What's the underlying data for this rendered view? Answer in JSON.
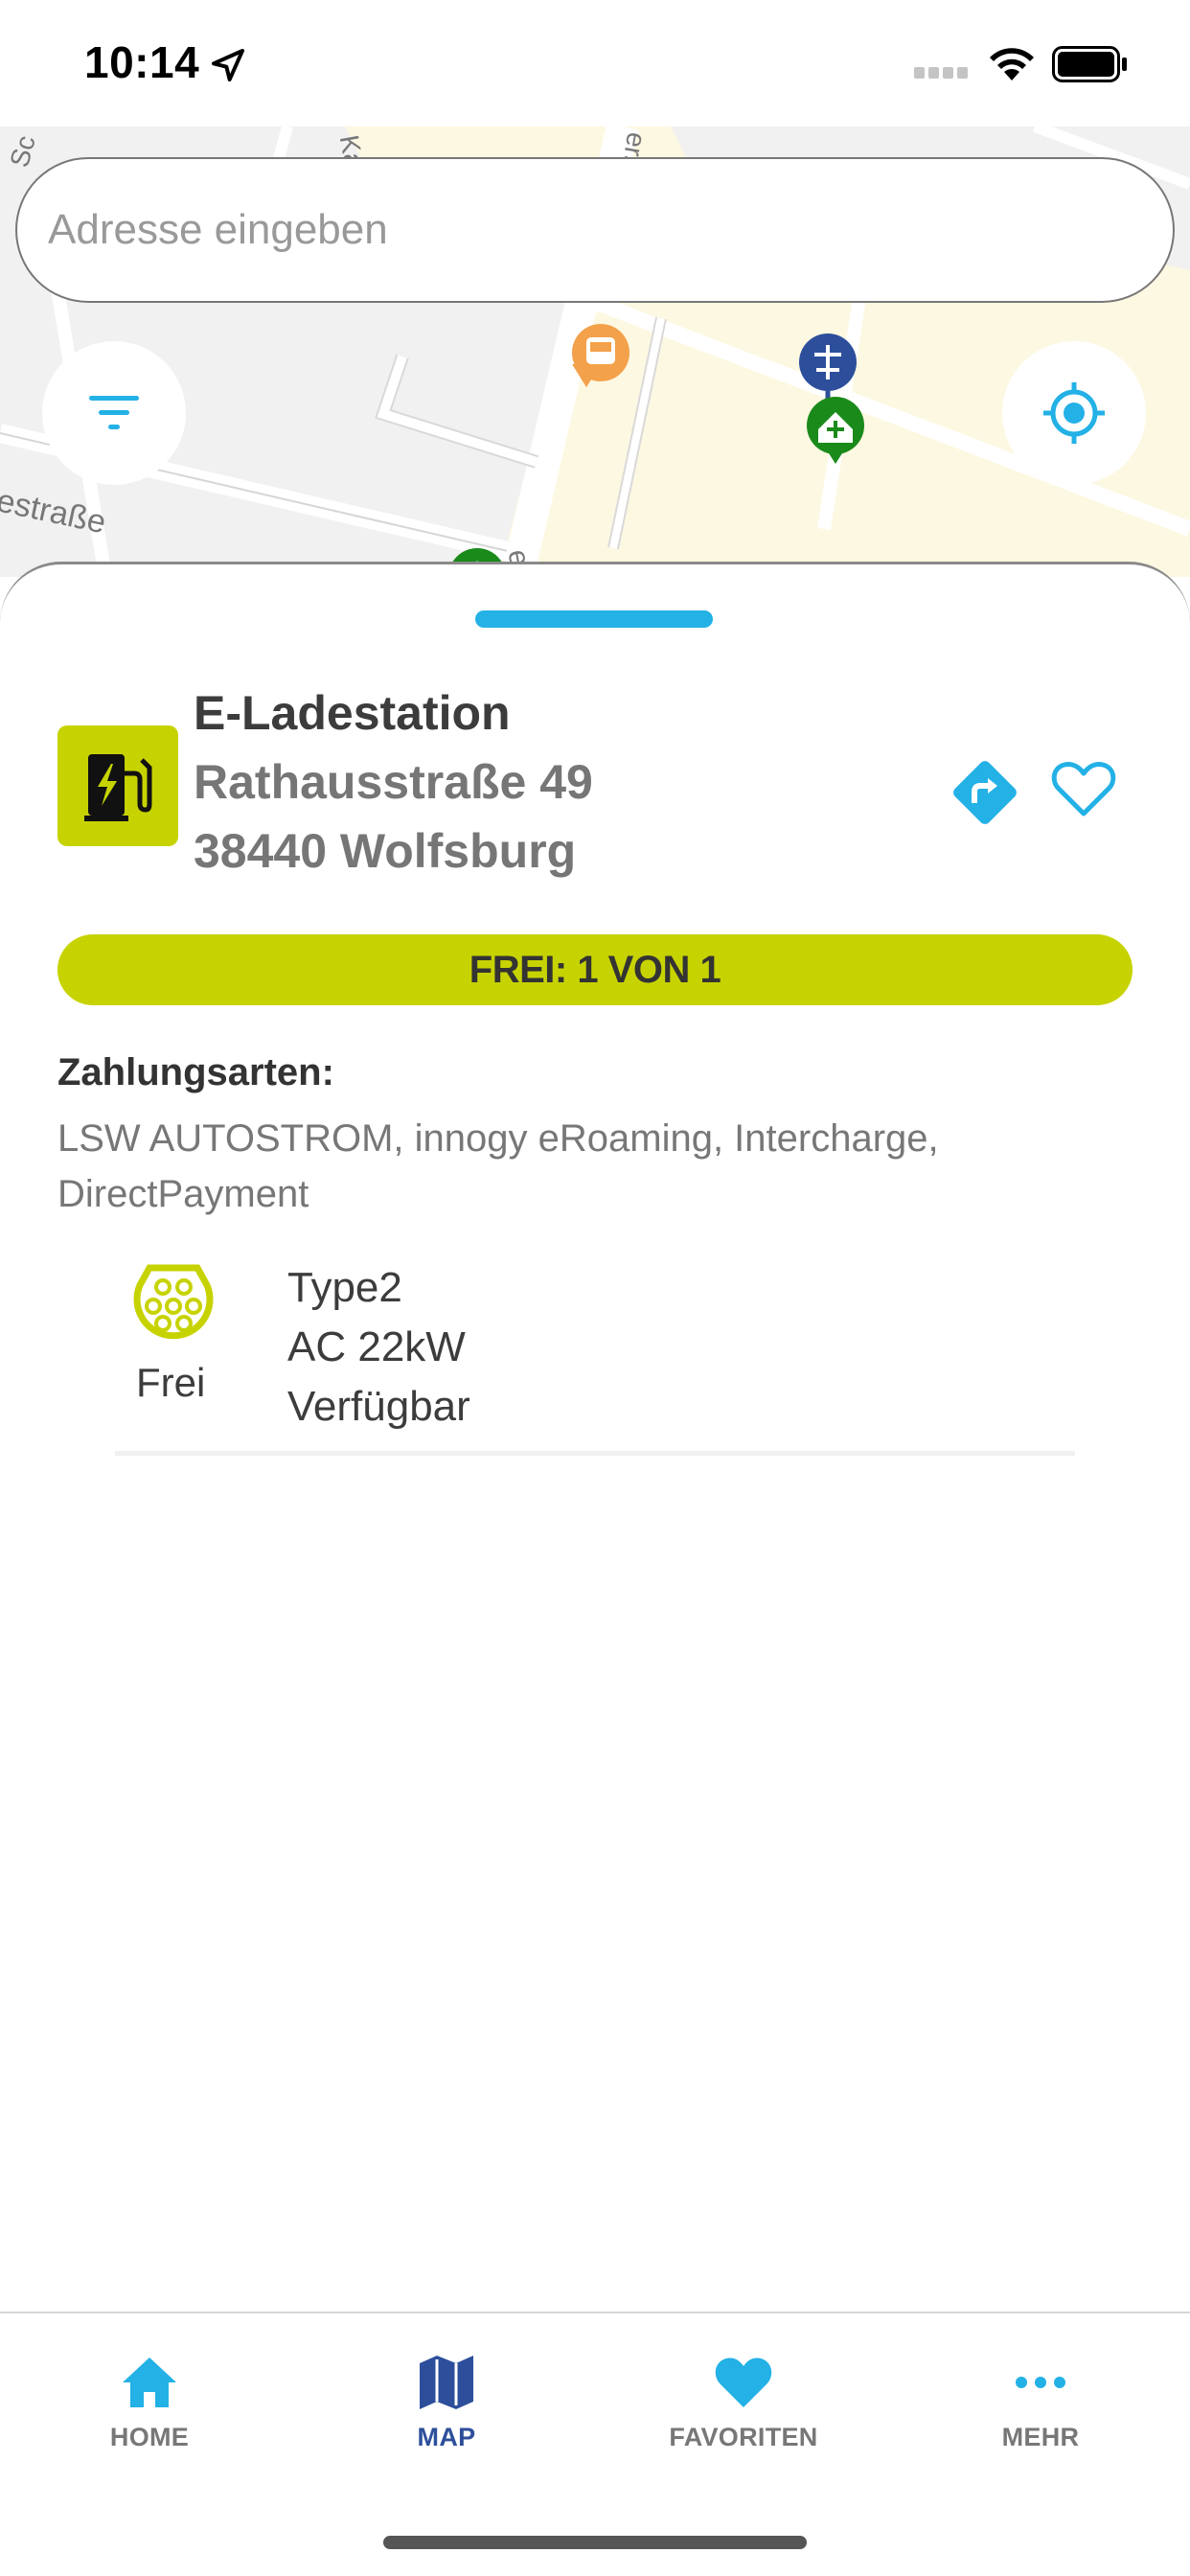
{
  "status_bar": {
    "time": "10:14"
  },
  "map": {
    "search_placeholder": "Adresse eingeben",
    "street_labels": [
      "Sc",
      "Ka",
      "ers",
      "estraße",
      "e"
    ]
  },
  "station": {
    "type": "E-Ladestation",
    "street": "Rathausstraße 49",
    "city": "38440 Wolfsburg",
    "availability": "FREI: 1 VON 1",
    "payment_title": "Zahlungsarten:",
    "payment_methods": "LSW AUTOSTROM, innogy eRoaming, Intercharge, DirectPayment",
    "connector": {
      "status": "Frei",
      "type": "Type2",
      "power": "AC 22kW",
      "availability": "Verfügbar"
    }
  },
  "tabs": [
    {
      "label": "HOME",
      "icon": "home-icon"
    },
    {
      "label": "MAP",
      "icon": "map-icon"
    },
    {
      "label": "FAVORITEN",
      "icon": "heart-icon"
    },
    {
      "label": "MEHR",
      "icon": "more-dots-icon"
    }
  ],
  "colors": {
    "accent_blue": "#23b1e6",
    "lime": "#c7d300",
    "active_tab": "#2d4f9b"
  }
}
